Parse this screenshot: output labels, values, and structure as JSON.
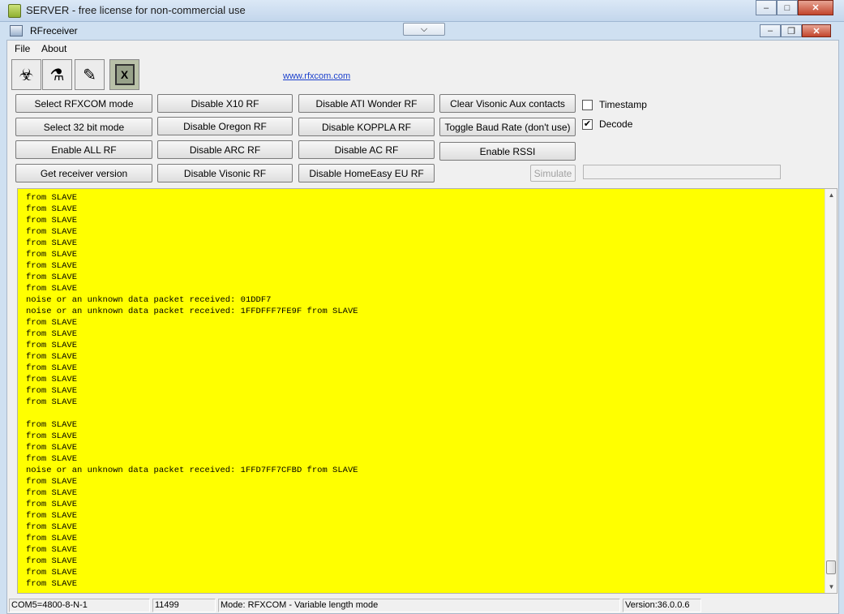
{
  "outer_window": {
    "title": "SERVER - free license for non-commercial use"
  },
  "window": {
    "title": "RFreceiver"
  },
  "menu": {
    "items": [
      "File",
      "About"
    ]
  },
  "toolbar": {
    "icons": [
      "receiver-icon",
      "receiver-plug-icon",
      "transmitter-icon",
      "exit-x-icon"
    ],
    "exit_label": "X"
  },
  "link": {
    "text": "www.rfxcom.com"
  },
  "buttons": {
    "col1": [
      "Select RFXCOM mode",
      "Select 32 bit mode",
      "Enable ALL RF",
      "Get receiver version"
    ],
    "col2": [
      "Disable X10 RF",
      "Disable Oregon RF",
      "Disable ARC RF",
      "Disable Visonic RF"
    ],
    "col3": [
      "Disable ATI Wonder RF",
      "Disable KOPPLA RF",
      "Disable AC RF",
      "Disable HomeEasy EU RF"
    ],
    "col4": [
      "Clear Visonic Aux contacts",
      "Toggle Baud Rate (don't use)",
      "Enable RSSI"
    ],
    "simulate": "Simulate"
  },
  "checkboxes": [
    {
      "label": "Timestamp",
      "checked": false
    },
    {
      "label": "Decode",
      "checked": true
    }
  ],
  "simulate_input": {
    "value": ""
  },
  "log": {
    "lines": [
      "from SLAVE",
      "from SLAVE",
      "from SLAVE",
      "from SLAVE",
      "from SLAVE",
      "from SLAVE",
      "from SLAVE",
      "from SLAVE",
      "from SLAVE",
      "noise or an unknown data packet received: 01DDF7",
      "noise or an unknown data packet received: 1FFDFFF7FE9F from SLAVE",
      "from SLAVE",
      "from SLAVE",
      "from SLAVE",
      "from SLAVE",
      "from SLAVE",
      "from SLAVE",
      "from SLAVE",
      "from SLAVE",
      "",
      "from SLAVE",
      "from SLAVE",
      "from SLAVE",
      "from SLAVE",
      "noise or an unknown data packet received: 1FFD7FF7CFBD from SLAVE",
      "from SLAVE",
      "from SLAVE",
      "from SLAVE",
      "from SLAVE",
      "from SLAVE",
      "from SLAVE",
      "from SLAVE",
      "from SLAVE",
      "from SLAVE",
      "from SLAVE"
    ]
  },
  "status": {
    "port": "COM5=4800-8-N-1",
    "count": "11499",
    "mode": "Mode: RFXCOM - Variable length mode",
    "version": "Version:36.0.0.6"
  },
  "colors": {
    "log_background": "#ffff00",
    "link": "#1a3fcc"
  }
}
